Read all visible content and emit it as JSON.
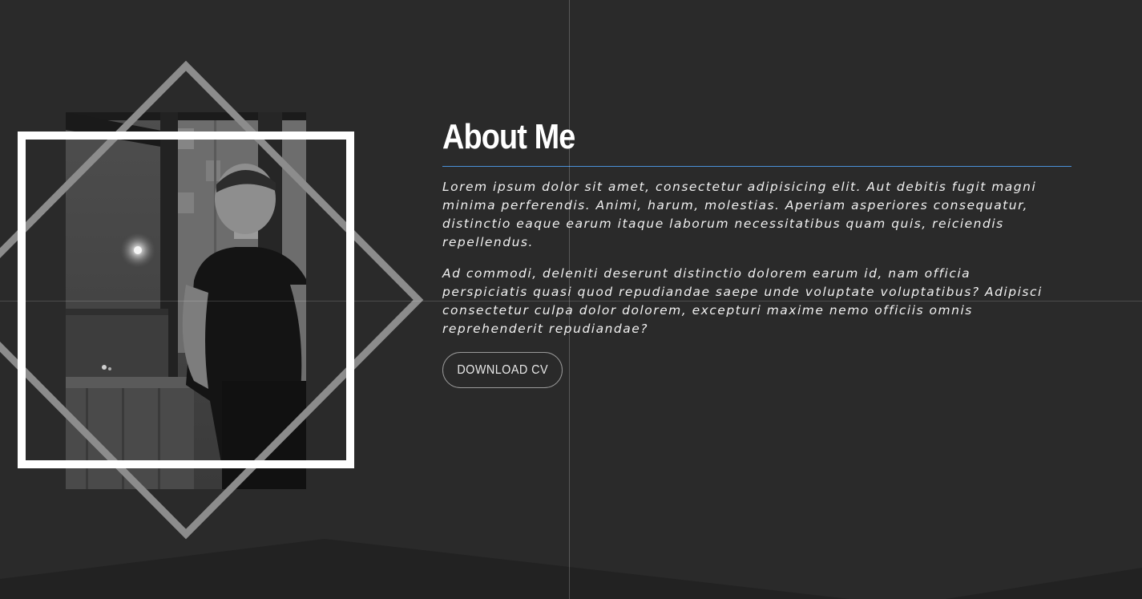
{
  "about": {
    "title": "About Me",
    "paragraphs": [
      "Lorem ipsum dolor sit amet, consectetur adipisicing elit. Aut debitis fugit magni minima perferendis. Animi, harum, molestias. Aperiam asperiores consequatur, distinctio eaque earum itaque laborum necessitatibus quam quis, reiciendis repellendus.",
      "Ad commodi, deleniti deserunt distinctio dolorem earum id, nam officia perspiciatis quasi quod repudiandae saepe unde voluptate voluptatibus? Adipisci consectetur culpa dolor dolorem, excepturi maxime nemo officiis omnis reprehenderit repudiandae?"
    ],
    "download_cv_label": "DOWNLOAD CV"
  },
  "colors": {
    "background": "#2a2a2a",
    "accent_rule": "#4a90d9",
    "frame": "#ffffff",
    "diamond": "#8c8c8c"
  }
}
